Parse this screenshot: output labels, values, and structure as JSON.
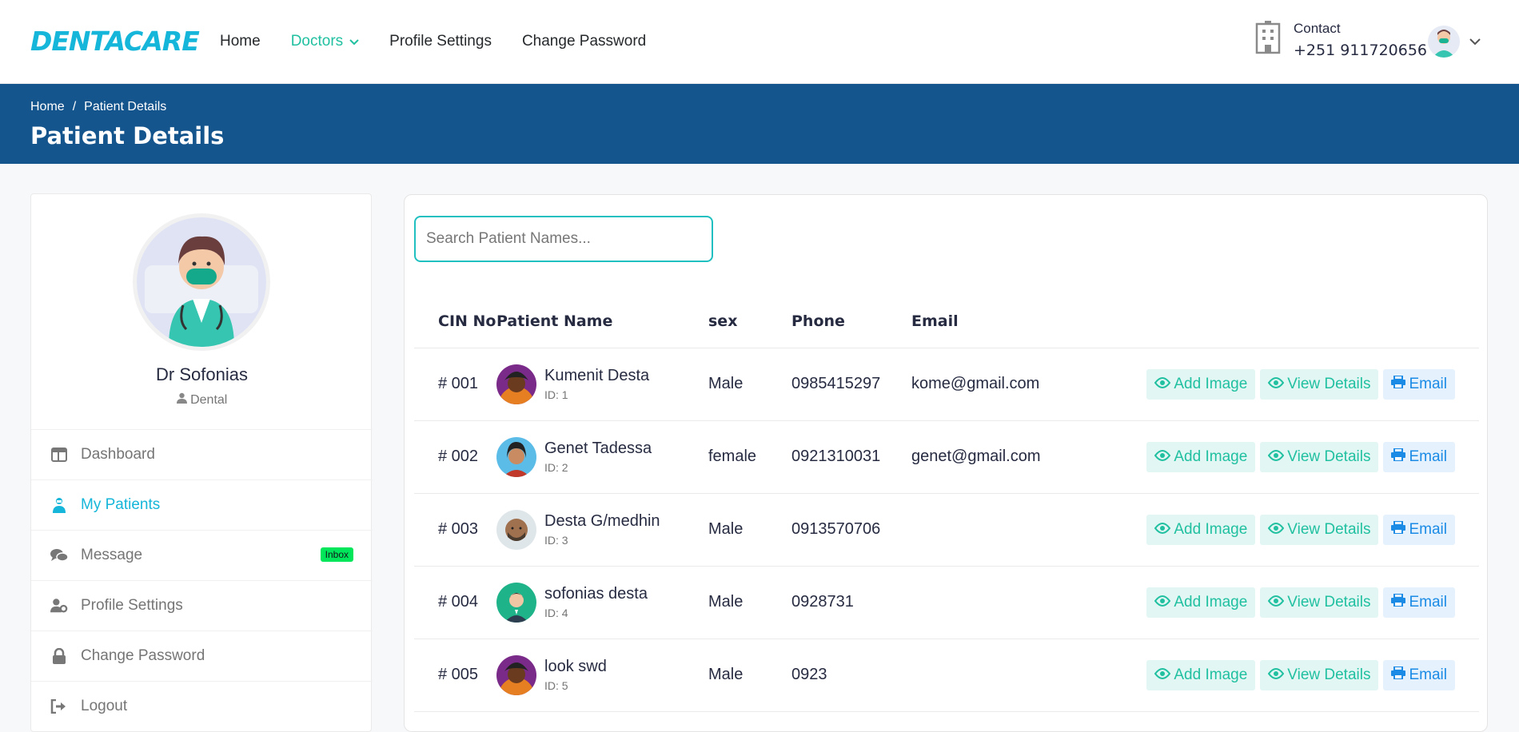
{
  "header": {
    "logo": "DENTACARE",
    "nav": [
      {
        "label": "Home",
        "active": false
      },
      {
        "label": "Doctors",
        "active": true
      },
      {
        "label": "Profile Settings",
        "active": false
      },
      {
        "label": "Change Password",
        "active": false
      }
    ],
    "contact_label": "Contact",
    "contact_phone": "+251 911720656"
  },
  "breadcrumb": {
    "items": [
      "Home",
      "Patient Details"
    ],
    "separator": "/",
    "page_title": "Patient Details"
  },
  "sidebar": {
    "doctor_name": "Dr Sofonias",
    "specialty": "Dental",
    "menu": [
      {
        "label": "Dashboard",
        "icon": "columns-icon",
        "active": false
      },
      {
        "label": "My Patients",
        "icon": "patient-icon",
        "active": true
      },
      {
        "label": "Message",
        "icon": "comments-icon",
        "active": false,
        "badge": "Inbox"
      },
      {
        "label": "Profile Settings",
        "icon": "user-cog-icon",
        "active": false
      },
      {
        "label": "Change Password",
        "icon": "lock-icon",
        "active": false
      },
      {
        "label": "Logout",
        "icon": "sign-out-icon",
        "active": false
      }
    ]
  },
  "search": {
    "placeholder": "Search Patient Names...",
    "value": ""
  },
  "table": {
    "columns": [
      "CIN No",
      "Patient Name",
      "sex",
      "Phone",
      "Email"
    ],
    "rows": [
      {
        "cin": "# 001",
        "name": "Kumenit Desta",
        "id": "ID: 1",
        "sex": "Male",
        "phone": "0985415297",
        "email": "kome@gmail.com"
      },
      {
        "cin": "# 002",
        "name": "Genet Tadessa",
        "id": "ID: 2",
        "sex": "female",
        "phone": "0921310031",
        "email": "genet@gmail.com"
      },
      {
        "cin": "# 003",
        "name": "Desta G/medhin",
        "id": "ID: 3",
        "sex": "Male",
        "phone": "0913570706",
        "email": ""
      },
      {
        "cin": "# 004",
        "name": "sofonias desta",
        "id": "ID: 4",
        "sex": "Male",
        "phone": "0928731",
        "email": ""
      },
      {
        "cin": "# 005",
        "name": "look swd",
        "id": "ID: 5",
        "sex": "Male",
        "phone": "0923",
        "email": ""
      }
    ],
    "actions": {
      "add_image": "Add Image",
      "view_details": "View Details",
      "email": "Email"
    }
  },
  "colors": {
    "brand": "#15b6d9",
    "accent": "#20c0a0",
    "banner": "#15558d",
    "email_btn": "#1b8be5"
  }
}
